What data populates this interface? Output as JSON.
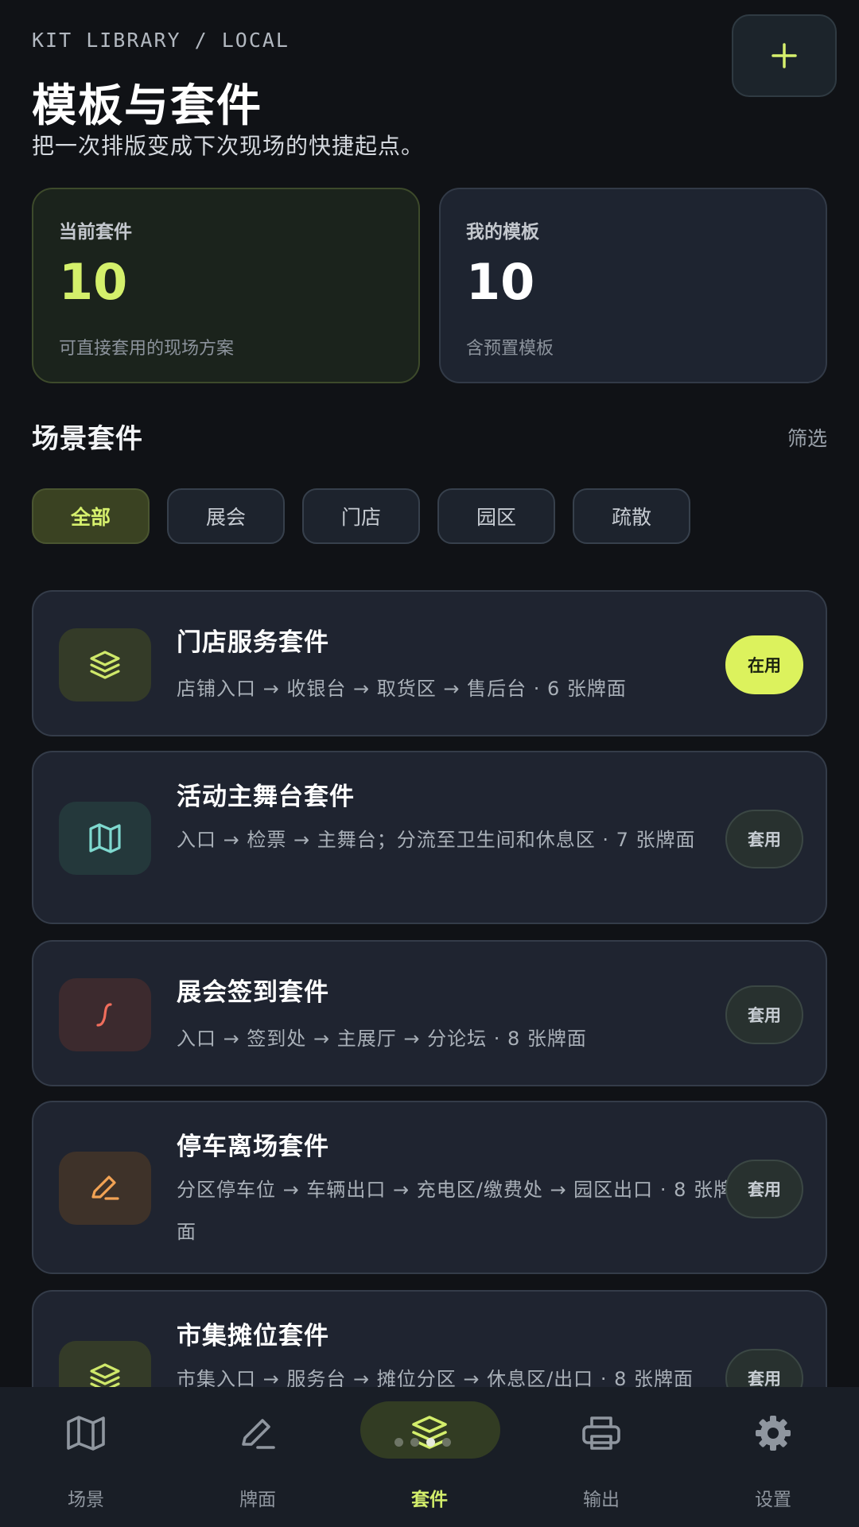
{
  "header": {
    "eyebrow": "KIT LIBRARY / LOCAL",
    "title": "模板与套件",
    "subtitle": "把一次排版变成下次现场的快捷起点。",
    "add_icon": "plus-icon"
  },
  "stats": [
    {
      "label": "当前套件",
      "value": "10",
      "note": "可直接套用的现场方案"
    },
    {
      "label": "我的模板",
      "value": "10",
      "note": "含预置模板"
    }
  ],
  "section": {
    "title": "场景套件",
    "filter_label": "筛选"
  },
  "chips": [
    {
      "label": "全部",
      "active": true
    },
    {
      "label": "展会",
      "active": false
    },
    {
      "label": "门店",
      "active": false
    },
    {
      "label": "园区",
      "active": false
    },
    {
      "label": "疏散",
      "active": false
    }
  ],
  "kits": [
    {
      "title": "门店服务套件",
      "desc": "店铺入口 → 收银台 → 取货区 → 售后台 · 6 张牌面",
      "button": "在用",
      "active": true,
      "icon": "layers-icon",
      "icon_color": "#cfe86a",
      "icon_bg": "#343b28"
    },
    {
      "title": "活动主舞台套件",
      "desc": "入口 → 检票 → 主舞台；分流至卫生间和休息区 · 7 张牌面",
      "button": "套用",
      "active": false,
      "icon": "map-icon",
      "icon_color": "#7fd9cf",
      "icon_bg": "#24383b"
    },
    {
      "title": "展会签到套件",
      "desc": "入口 → 签到处 → 主展厅 → 分论坛 · 8 张牌面",
      "button": "套用",
      "active": false,
      "icon": "route-icon",
      "icon_color": "#f06d5c",
      "icon_bg": "#3c2a2e"
    },
    {
      "title": "停车离场套件",
      "desc": "分区停车位 → 车辆出口 → 充电区/缴费处 → 园区出口 · 8 张牌面",
      "button": "套用",
      "active": false,
      "icon": "pen-icon",
      "icon_color": "#f2a354",
      "icon_bg": "#3e3229"
    },
    {
      "title": "市集摊位套件",
      "desc": "市集入口 → 服务台 → 摊位分区 → 休息区/出口 · 8 张牌面",
      "button": "套用",
      "active": false,
      "icon": "layers-icon",
      "icon_color": "#cfe86a",
      "icon_bg": "#343b28"
    }
  ],
  "nav": [
    {
      "label": "场景",
      "icon": "map-icon",
      "active": false
    },
    {
      "label": "牌面",
      "icon": "pen-icon",
      "active": false
    },
    {
      "label": "套件",
      "icon": "layers-icon",
      "active": true
    },
    {
      "label": "输出",
      "icon": "printer-icon",
      "active": false
    },
    {
      "label": "设置",
      "icon": "gear-icon",
      "active": false
    }
  ],
  "colors": {
    "accent": "#d6f06d",
    "background": "#101216",
    "card": "#1f2430"
  }
}
